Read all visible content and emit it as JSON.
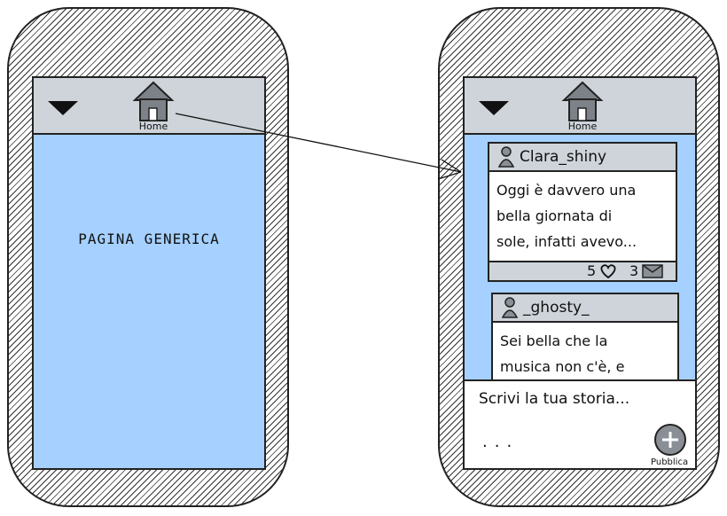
{
  "left_phone": {
    "menu_icon": "dropdown-triangle-icon",
    "home_icon": "home-icon",
    "home_label": "Home",
    "page_text": "PAGINA GENERICA"
  },
  "right_phone": {
    "menu_icon": "dropdown-triangle-icon",
    "home_icon": "home-icon",
    "home_label": "Home",
    "posts": [
      {
        "user": "Clara_shiny",
        "user_icon": "user-icon",
        "lines": [
          "Oggi è davvero una",
          "bella giornata di",
          "sole, infatti avevo..."
        ],
        "likes": "5",
        "like_icon": "heart-icon",
        "comments": "3",
        "comment_icon": "envelope-icon"
      },
      {
        "user": "_ghosty_",
        "user_icon": "user-icon",
        "lines": [
          "Sei bella che la",
          "musica non c'è, e"
        ]
      }
    ],
    "composer": {
      "placeholder": "Scrivi la tua storia...",
      "dots": "...",
      "publish_label": "Pubblica",
      "publish_icon": "plus-icon"
    }
  },
  "colors": {
    "content_blue": "#a5d0ff",
    "bar_gray": "#ced4da",
    "outline": "#222222"
  }
}
